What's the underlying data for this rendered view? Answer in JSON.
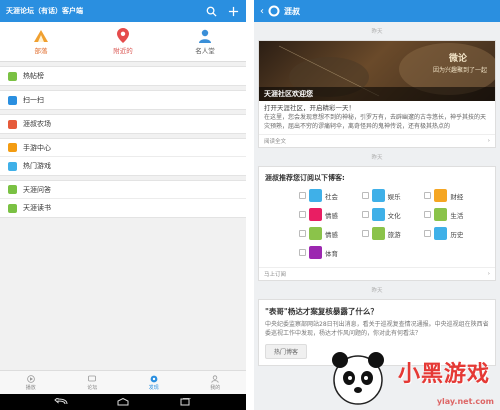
{
  "left": {
    "app_title": "天涯论坛（有话）客户端",
    "quick": [
      {
        "label": "部落",
        "icon": "tent-icon",
        "color": "#f0a030"
      },
      {
        "label": "附近的",
        "icon": "location-pin-icon",
        "color": "#e54b4b"
      },
      {
        "label": "名人堂",
        "icon": "person-icon",
        "color": "#3a8fd8"
      }
    ],
    "groups": [
      [
        {
          "label": "热帖榜",
          "icon": "hot-list-icon",
          "color": "#7ac143"
        }
      ],
      [
        {
          "label": "扫一扫",
          "icon": "scan-icon",
          "color": "#2a8fe0"
        }
      ],
      [
        {
          "label": "涯叔农场",
          "icon": "farm-icon",
          "color": "#e65a3a"
        }
      ],
      [
        {
          "label": "手游中心",
          "icon": "game-center-icon",
          "color": "#f39c12"
        },
        {
          "label": "热门游戏",
          "icon": "game-icon",
          "color": "#3fb0e8"
        }
      ],
      [
        {
          "label": "天涯问答",
          "icon": "qa-icon",
          "color": "#7ac143"
        },
        {
          "label": "天涯读书",
          "icon": "book-icon",
          "color": "#7ac143"
        }
      ]
    ],
    "bottomnav": [
      {
        "label": "播放",
        "icon": "play-icon"
      },
      {
        "label": "论坛",
        "icon": "forum-icon"
      },
      {
        "label": "发现",
        "icon": "discover-icon"
      },
      {
        "label": "我的",
        "icon": "profile-icon"
      }
    ]
  },
  "right": {
    "title": "涯叔",
    "divider1": "昨天",
    "welcome": {
      "banner_badge": "微论",
      "banner_tagline": "因为兴趣聚到了一起",
      "banner_title": "天涯社区欢迎您",
      "lead": "打开天涯社区，开启精彩一天！",
      "body": "在这里，您会发现意想不到的神秘，引罗万有，去辟幽邃的古寺悠长，神乎其技的天灾预熟，屈出不穷的谬痛轲伞，离奇怪异的鬼神传说，还有极其热点的",
      "foot": "阅读全文"
    },
    "divider2": "昨天",
    "subscribe": {
      "title": "涯叔推荐您订阅以下博客:",
      "items": [
        {
          "label": "社会",
          "icon": "society-icon",
          "color": "#3fb0e8"
        },
        {
          "label": "娱乐",
          "icon": "entertainment-icon",
          "color": "#3fb0e8"
        },
        {
          "label": "财经",
          "icon": "finance-icon",
          "color": "#f5a623"
        },
        {
          "label": "情感",
          "icon": "emotion-icon",
          "color": "#e91e63"
        },
        {
          "label": "文化",
          "icon": "culture-icon",
          "color": "#3fb0e8"
        },
        {
          "label": "生活",
          "icon": "life-icon",
          "color": "#8bc34a"
        },
        {
          "label": "情感",
          "icon": "emotion-icon",
          "color": "#8bc34a"
        },
        {
          "label": "旅游",
          "icon": "travel-icon",
          "color": "#8bc34a"
        },
        {
          "label": "历史",
          "icon": "history-icon",
          "color": "#3fb0e8"
        },
        {
          "label": "体育",
          "icon": "sports-icon",
          "color": "#9c27b0"
        }
      ],
      "foot": "马上订阅"
    },
    "divider3": "昨天",
    "news": {
      "title": "\"表哥\"杨达才案复核暴露了什么？",
      "body": "中央纪委监察部网站28日刊出消息，看关于巡视复查情况通报。中央巡视组在陕西省委巡视工作中发现，杨达才作风问题的，你对此有何看法？",
      "button": "热门博客"
    },
    "watermark": {
      "big": "小黑游戏",
      "small": "ylay.net.com"
    }
  }
}
